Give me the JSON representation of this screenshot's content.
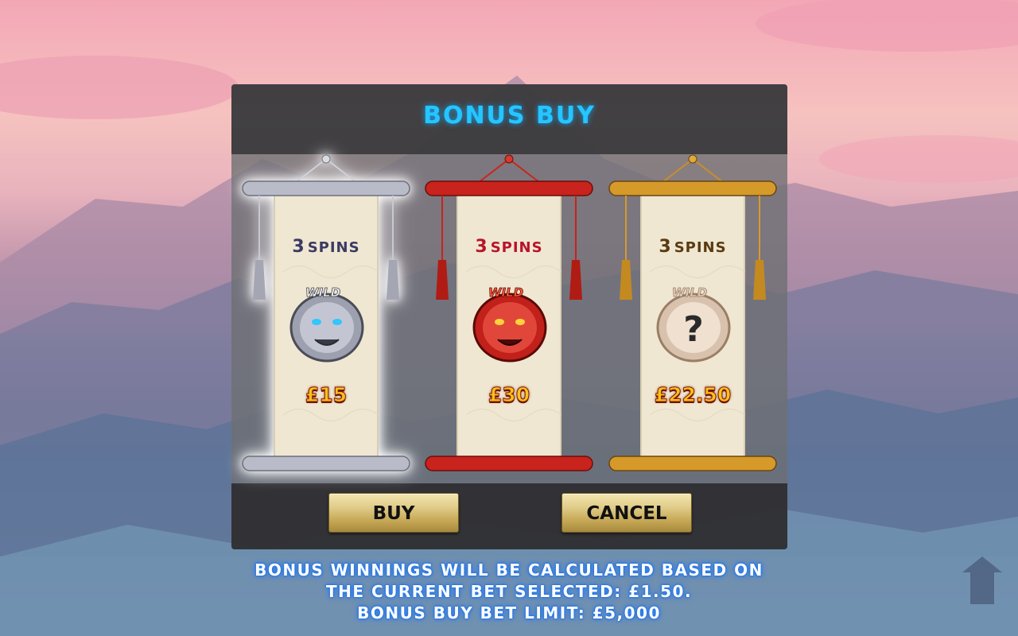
{
  "dialog": {
    "title": "BONUS BUY"
  },
  "options": [
    {
      "spins_number": "3",
      "spins_word": "SPINS",
      "price": "£15",
      "theme": "silver",
      "selected": true,
      "spins_color": "#3b3a63",
      "has_question_mark": false
    },
    {
      "spins_number": "3",
      "spins_word": "SPINS",
      "price": "£30",
      "theme": "red",
      "selected": false,
      "spins_color": "#b8142a",
      "has_question_mark": false
    },
    {
      "spins_number": "3",
      "spins_word": "SPINS",
      "price": "£22.50",
      "theme": "gold",
      "selected": false,
      "spins_color": "#5b3a12",
      "has_question_mark": true,
      "question_mark": "?"
    }
  ],
  "tiger_label": "WILD",
  "buttons": {
    "buy": "BUY",
    "cancel": "CANCEL"
  },
  "notice": {
    "line1": "BONUS WINNINGS WILL BE CALCULATED BASED ON",
    "line2": "THE CURRENT BET SELECTED: £1.50.",
    "line3": "BONUS BUY BET LIMIT: £5,000"
  },
  "colors": {
    "title": "#25c6ff",
    "price": "#f9c21a",
    "silver": "#b9bcc8",
    "red": "#c8231c",
    "gold": "#d69a2a",
    "parchment": "#f1e9d6"
  }
}
